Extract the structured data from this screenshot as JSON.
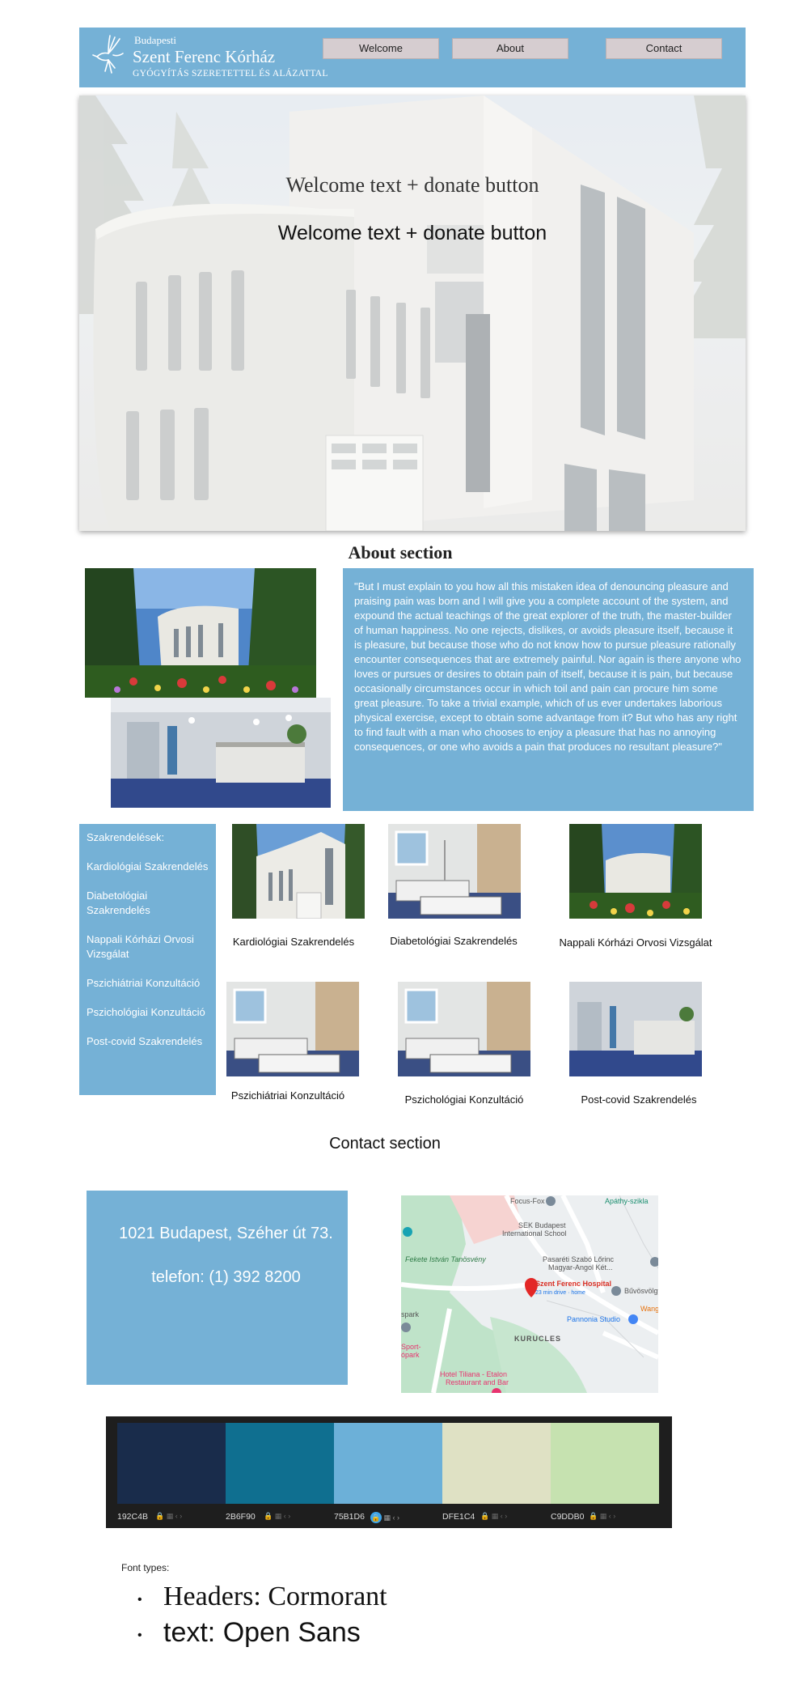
{
  "header": {
    "brand_small": "Budapesti",
    "brand_name": "Szent Ferenc Kórház",
    "brand_motto": "GYÓGYÍTÁS SZERETETTEL ÉS ALÁZATTAL",
    "nav": [
      {
        "label": "Welcome"
      },
      {
        "label": "About"
      },
      {
        "label": "Contact"
      }
    ],
    "bg_color": "#75b1d6"
  },
  "hero": {
    "title_serif": "Welcome text + donate button",
    "title_sans": "Welcome text + donate button"
  },
  "about": {
    "title": "About section",
    "paragraph_1": "\"But I must explain to you how all this mistaken idea of denouncing pleasure and praising pain was born and I will give you a complete account of the system, and expound the actual teachings of the great explorer of the truth, the master-builder of human happiness. No one rejects, dislikes, or avoids pleasure itself, because it is pleasure, but because those who do not know how to pursue pleasure rationally encounter consequences that are extremely painful. Nor again is there anyone who",
    "paragraph_2": "loves or pursues or desires to obtain pain of itself, because it is pain, but because occasionally circumstances occur in which toil and pain can procure him some great pleasure. To take a trivial example, which of us ever undertakes laborious physical exercise, except to obtain some advantage from it? But who has any right to find fault with a man who chooses to enjoy a pleasure that has no annoying consequences, or one who avoids a pain that produces no resultant pleasure?\""
  },
  "services": {
    "sidebar_heading": "Szakrendelések:",
    "sidebar_items": [
      "Kardiológiai Szakrendelés",
      "Diabetológiai Szakrendelés",
      "Nappali Kórházi Orvosi Vizsgálat",
      "Pszichiátriai Konzultáció",
      " Pszichológiai Konzultáció",
      "Post-covid Szakrendelés"
    ],
    "cards": [
      {
        "label": "Kardiológiai Szakrendelés",
        "image": "building-photo"
      },
      {
        "label": "Diabetológiai Szakrendelés",
        "image": "hospital-beds-photo"
      },
      {
        "label": "Nappali Kórházi Orvosi Vizsgálat",
        "image": "garden-building-photo"
      },
      {
        "label": "Pszichiátriai Konzultáció",
        "image": "hospital-beds-photo"
      },
      {
        "label": "Pszichológiai Konzultáció",
        "image": "hospital-beds-photo"
      },
      {
        "label": "Post-covid Szakrendelés",
        "image": "reception-hall-photo"
      }
    ]
  },
  "contact": {
    "title": "Contact section",
    "address": "1021 Budapest, Széher út 73.",
    "phone": "telefon: (1) 392 8200",
    "map": {
      "labels": {
        "focus_fox": "Focus-Fox",
        "apathy": "Apáthy-szikla",
        "sek": "SEK Budapest",
        "sek2": "International School",
        "fekete": "Fekete István Tanösvény",
        "pasareti": "Pasaréti Szabó Lőrinc",
        "pasareti2": "Magyar-Angol Két...",
        "hospital": "Szent Ferenc Hospital",
        "hospital_sub": "23 min drive · home",
        "buvosvolgy": "Bűvösvölgy",
        "pannonia": "Pannonia Studio",
        "wang": "Wang",
        "kurucles": "KURUCLES",
        "sport": "Sport-",
        "park": "ópark",
        "spark": "spark",
        "tiliana": "Hotel Tiliana - Etalon",
        "tiliana2": "Restaurant and Bar"
      }
    }
  },
  "palette": {
    "swatches": [
      {
        "hex": "192C4B",
        "color": "#192C4B"
      },
      {
        "hex": "2B6F90",
        "color": "#0f6f90"
      },
      {
        "hex": "75B1D6",
        "color": "#6cb0d8"
      },
      {
        "hex": "DFE1C4",
        "color": "#dfe1c4"
      },
      {
        "hex": "C9DDB0",
        "color": "#c6e2b0"
      }
    ]
  },
  "fonts": {
    "caption": "Font types:",
    "line1": "Headers: Cormorant",
    "line2": "text: Open Sans",
    "bullet": "•"
  }
}
